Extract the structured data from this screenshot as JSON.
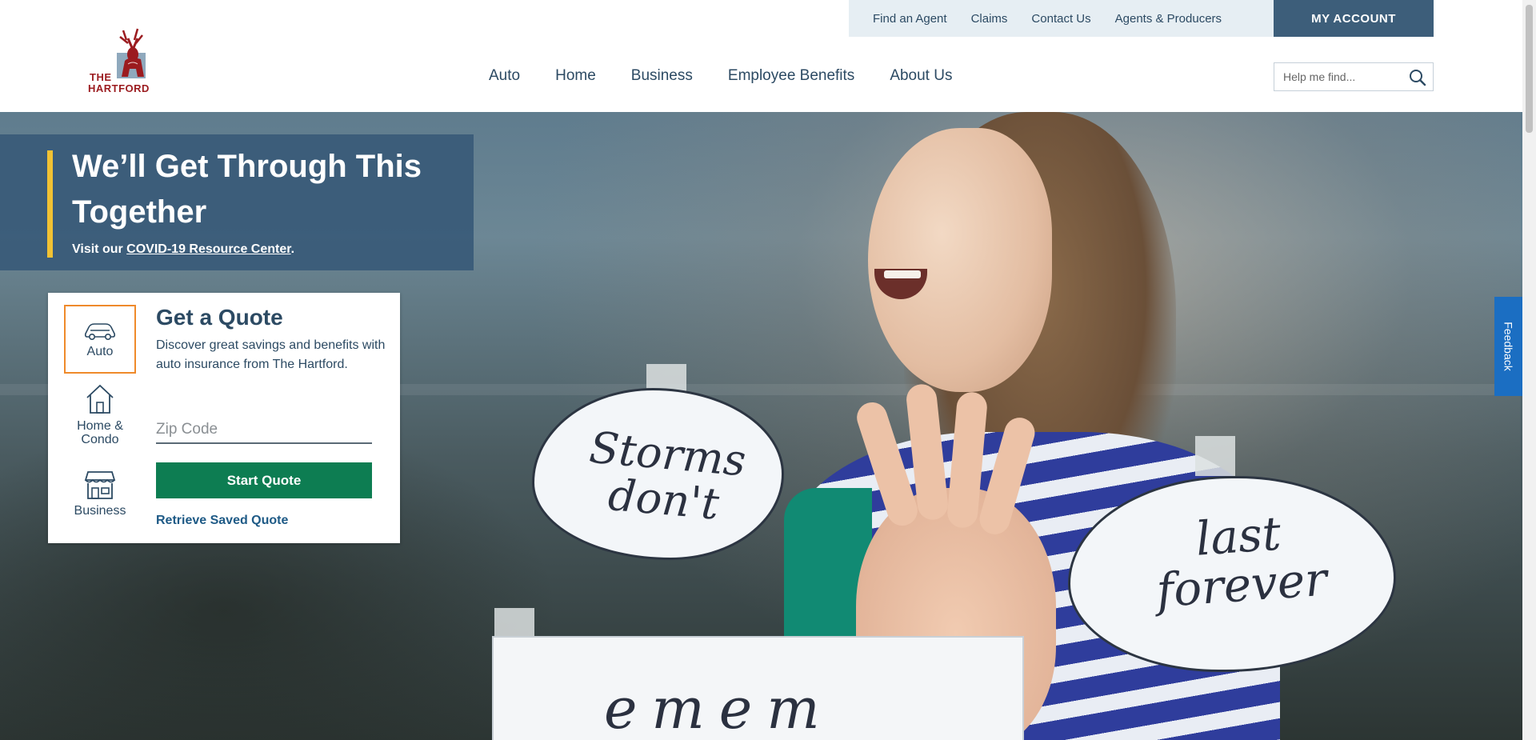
{
  "header": {
    "logo": {
      "line1": "THE",
      "line2": "HARTFORD",
      "icon": "stag-logo-icon"
    },
    "utility_links": [
      "Find an Agent",
      "Claims",
      "Contact Us",
      "Agents & Producers"
    ],
    "my_account": "MY ACCOUNT",
    "nav": [
      "Auto",
      "Home",
      "Business",
      "Employee Benefits",
      "About Us"
    ],
    "search": {
      "placeholder": "Help me find...",
      "value": "",
      "icon": "search-icon"
    }
  },
  "hero": {
    "title": "We’ll Get Through This Together",
    "subtitle_prefix": "Visit our ",
    "subtitle_link": "COVID-19 Resource Center",
    "subtitle_suffix": ".",
    "photo_text": {
      "cloud1_line1": "Storms",
      "cloud1_line2": "don't",
      "cloud2_line1": "last",
      "cloud2_line2": "forever",
      "sign": "emem"
    }
  },
  "quote": {
    "tabs": [
      {
        "label": "Auto",
        "icon": "car-icon",
        "active": true
      },
      {
        "label": "Home & Condo",
        "icon": "house-icon",
        "active": false
      },
      {
        "label": "Business",
        "icon": "storefront-icon",
        "active": false
      }
    ],
    "title": "Get a Quote",
    "description": "Discover great savings and benefits with auto insurance from The Hartford.",
    "zip_placeholder": "Zip Code",
    "zip_value": "",
    "start_button": "Start Quote",
    "retrieve_link": "Retrieve Saved Quote"
  },
  "feedback": "Feedback",
  "colors": {
    "navy": "#2c4a63",
    "account_bg": "#3d5e7a",
    "banner_bg": "#395a79",
    "accent_yellow": "#f2c233",
    "tab_active_border": "#ef8a2b",
    "start_button": "#0d7d52",
    "brand_red": "#9b1b1f",
    "feedback_bg": "#1b6ec2"
  }
}
